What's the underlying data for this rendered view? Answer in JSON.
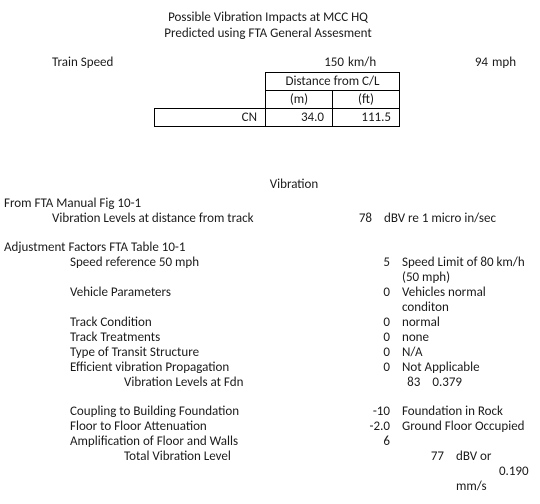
{
  "title": "Possible Vibration Impacts at MCC HQ",
  "subtitle": "Predicted using FTA General Assesment",
  "train_speed": {
    "label": "Train Speed",
    "kmh": "150",
    "kmh_unit": "km/h",
    "mph": "94",
    "mph_unit": "mph"
  },
  "dist_table": {
    "header": "Distance from C/L",
    "col_m": "(m)",
    "col_ft": "(ft)",
    "row_label": "CN",
    "m_val": "34.0",
    "ft_val": "111.5"
  },
  "vibration_header": "Vibration",
  "fta_source": "From FTA Manual Fig 10-1",
  "vib_at_dist": {
    "label": "Vibration Levels at distance from track",
    "value": "78",
    "note": "dBV re 1 micro in/sec"
  },
  "adj_header": "Adjustment Factors FTA Table 10-1",
  "factors": [
    {
      "label": "Speed reference 50 mph",
      "value": "5",
      "note": "Speed Limit of 80 km/h (50 mph)"
    },
    {
      "label": "Vehicle Parameters",
      "value": "0",
      "note": "Vehicles normal conditon"
    },
    {
      "label": "Track Condition",
      "value": "0",
      "note": "normal"
    },
    {
      "label": "Track Treatments",
      "value": "0",
      "note": "none"
    },
    {
      "label": "Type of Transit Structure",
      "value": "0",
      "note": "N/A"
    },
    {
      "label": "Efficient vibration Propagation",
      "value": "0",
      "note": "Not Applicable"
    }
  ],
  "vib_at_fdn": {
    "label": "Vibration Levels at Fdn",
    "value": "83",
    "extra": "0.379"
  },
  "building": [
    {
      "label": "Coupling to Building Foundation",
      "value": "-10",
      "note": "Foundation in Rock"
    },
    {
      "label": "Floor to Floor Attenuation",
      "value": "-2.0",
      "note": "Ground Floor Occupied"
    },
    {
      "label": "Amplification of Floor and Walls",
      "value": "6",
      "note": ""
    }
  ],
  "total": {
    "label": "Total Vibration Level",
    "value": "77",
    "unit": "dBV or",
    "mm_s": "0.190",
    "mm_s_unit": "mm/s"
  }
}
